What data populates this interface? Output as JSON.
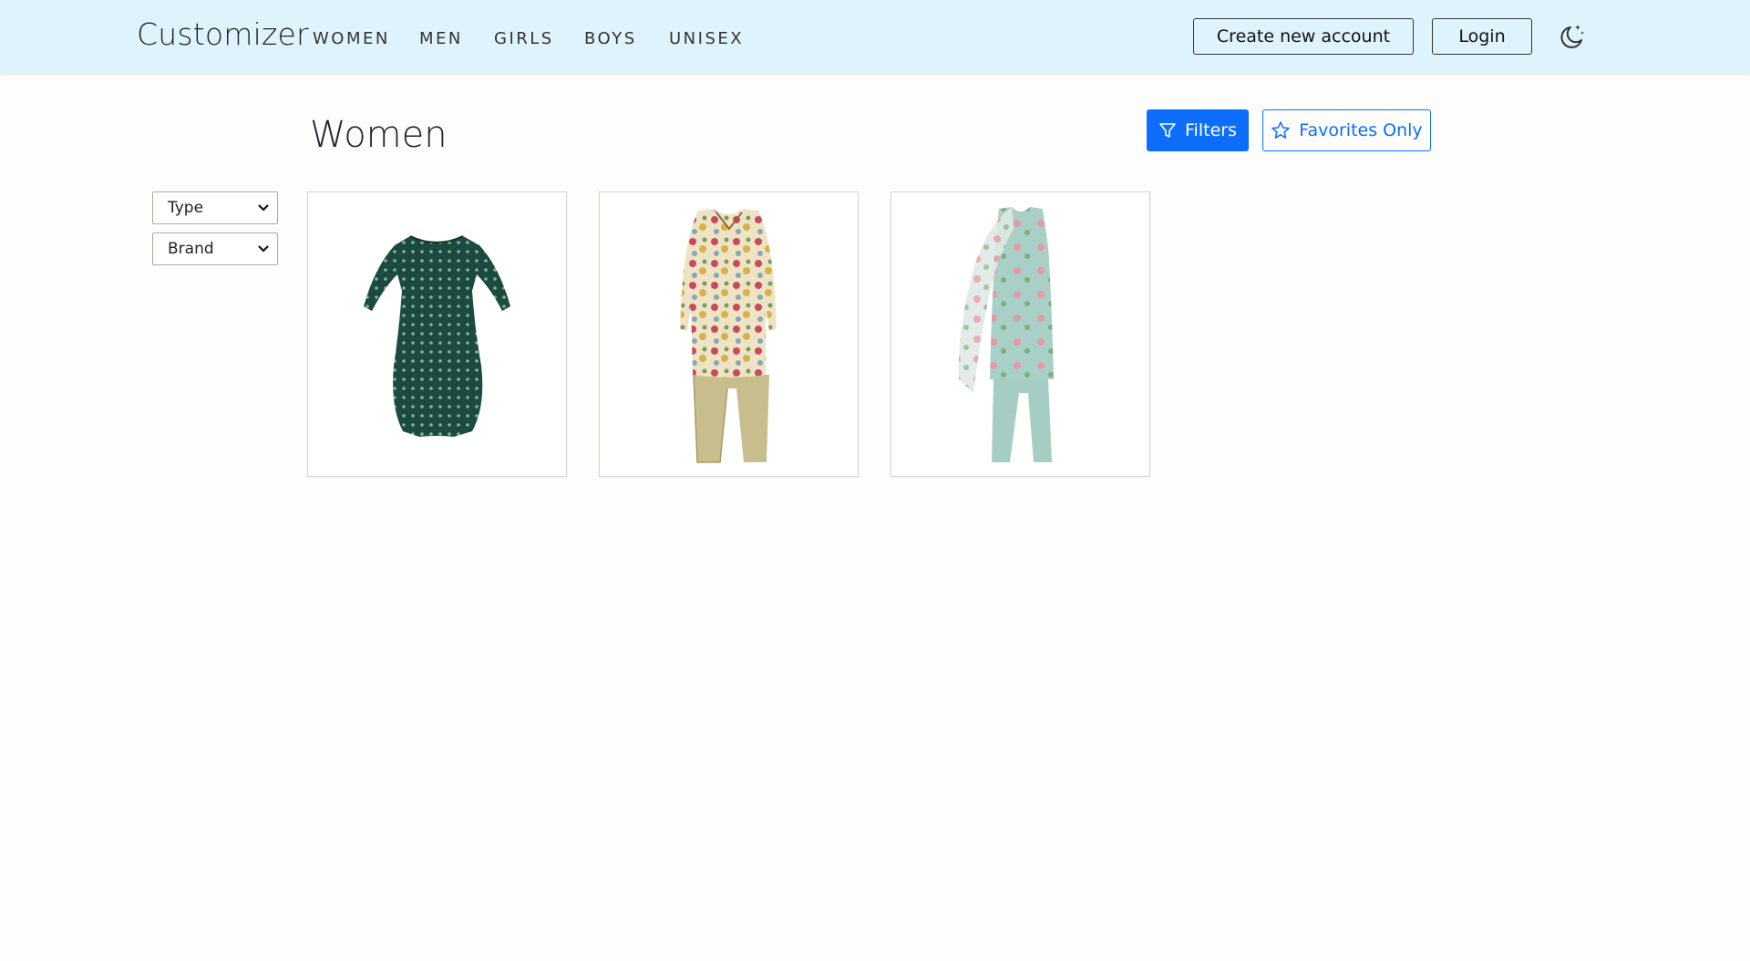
{
  "nav": {
    "brand": "Customizer",
    "links": [
      "WOMEN",
      "MEN",
      "GIRLS",
      "BOYS",
      "UNISEX"
    ],
    "create_account": "Create new account",
    "login": "Login",
    "theme_icon": "moon-stars-icon"
  },
  "page": {
    "title": "Women",
    "filters_label": "Filters",
    "favorites_label": "Favorites Only"
  },
  "sidebar": {
    "selects": [
      "Type",
      "Brand"
    ]
  },
  "products": [
    {
      "name": "green-dotted-dress",
      "colors": [
        "#1c4b40",
        "#2e6b58"
      ]
    },
    {
      "name": "floral-shirt-khaki-pants",
      "colors": [
        "#c9b98a",
        "#d8c98f"
      ]
    },
    {
      "name": "mint-floral-suit-dupatta",
      "colors": [
        "#a8cfc6",
        "#e6a0a8"
      ]
    }
  ],
  "colors": {
    "navbar_bg": "#dff3fc",
    "primary": "#0d6efd",
    "page_bg": "#fdfdfb"
  }
}
